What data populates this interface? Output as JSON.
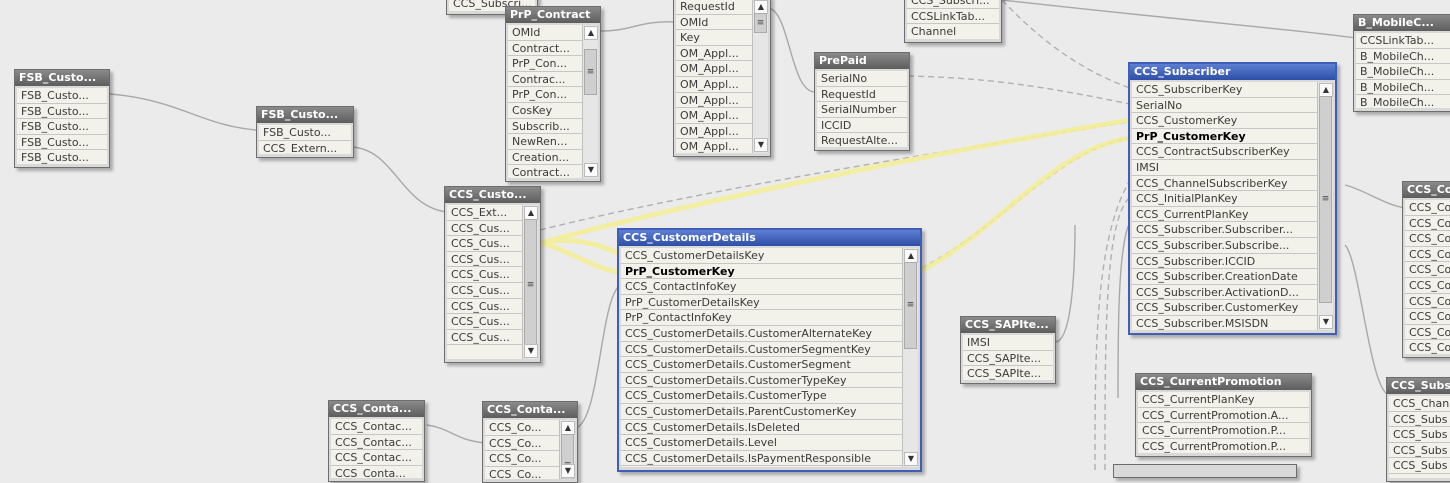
{
  "tables": [
    {
      "id": "ccs-subsc-top",
      "title": "",
      "fields": [
        "CCS_Subscri..."
      ]
    },
    {
      "id": "prp-contract",
      "title": "PrP_Contract",
      "fields": [
        "OMId",
        "Contract...",
        "PrP_Con...",
        "Contrac...",
        "PrP_Con...",
        "CosKey",
        "Subscrib...",
        "NewRen...",
        "Creation...",
        "Contract..."
      ]
    },
    {
      "id": "requestid",
      "title": "",
      "fields": [
        "RequestId",
        "OMId",
        "Key",
        "OM_Appl...",
        "OM_Appl...",
        "OM_Appl...",
        "OM_Appl...",
        "OM_Appl...",
        "OM_Appl...",
        "OM_Appl..."
      ]
    },
    {
      "id": "ccs-link",
      "title": "",
      "fields": [
        "CCS_Subscri...",
        "CCSLinkTab...",
        "Channel"
      ]
    },
    {
      "id": "b-mobilec",
      "title": "B_MobileC...",
      "fields": [
        "CCSLinkTab...",
        "B_MobileCh...",
        "B_MobileCh...",
        "B_MobileCh...",
        "B_MobileCh..."
      ]
    },
    {
      "id": "fsb-custo-1",
      "title": "FSB_Custo...",
      "fields": [
        "FSB_Custo...",
        "FSB_Custo...",
        "FSB_Custo...",
        "FSB_Custo...",
        "FSB_Custo..."
      ]
    },
    {
      "id": "fsb-custo-2",
      "title": "FSB_Custo...",
      "fields": [
        "FSB_Custo...",
        "CCS_Extern..."
      ]
    },
    {
      "id": "prepaid",
      "title": "PrePaid",
      "fields": [
        "SerialNo",
        "RequestId",
        "SerialNumber",
        "ICCID",
        "RequestAlte..."
      ]
    },
    {
      "id": "ccs-subscriber",
      "title": "CCS_Subscriber",
      "fields": [
        "CCS_SubscriberKey",
        "SerialNo",
        "CCS_CustomerKey",
        "PrP_CustomerKey",
        "CCS_ContractSubscriberKey",
        "IMSI",
        "CCS_ChannelSubscriberKey",
        "CCS_InitialPlanKey",
        "CCS_CurrentPlanKey",
        "CCS_Subscriber.Subscriber...",
        "CCS_Subscriber.Subscribe...",
        "CCS_Subscriber.ICCID",
        "CCS_Subscriber.CreationDate",
        "CCS_Subscriber.ActivationD...",
        "CCS_Subscriber.CustomerKey",
        "CCS_Subscriber.MSISDN"
      ]
    },
    {
      "id": "ccs-custo",
      "title": "CCS_Custo...",
      "fields": [
        "CCS_Ext...",
        "CCS_Cus...",
        "CCS_Cus...",
        "CCS_Cus...",
        "CCS_Cus...",
        "CCS_Cus...",
        "CCS_Cus...",
        "CCS_Cus...",
        "CCS_Cus..."
      ]
    },
    {
      "id": "ccs-customerdetails",
      "title": "CCS_CustomerDetails",
      "fields": [
        "CCS_CustomerDetailsKey",
        "PrP_CustomerKey",
        "CCS_ContactInfoKey",
        "PrP_CustomerDetailsKey",
        "PrP_ContactInfoKey",
        "CCS_CustomerDetails.CustomerAlternateKey",
        "CCS_CustomerDetails.CustomerSegmentKey",
        "CCS_CustomerDetails.CustomerSegment",
        "CCS_CustomerDetails.CustomerTypeKey",
        "CCS_CustomerDetails.CustomerType",
        "CCS_CustomerDetails.ParentCustomerKey",
        "CCS_CustomerDetails.IsDeleted",
        "CCS_CustomerDetails.Level",
        "CCS_CustomerDetails.IsPaymentResponsible"
      ]
    },
    {
      "id": "ccs-sapite",
      "title": "CCS_SAPIte...",
      "fields": [
        "IMSI",
        "CCS_SAPIte...",
        "CCS_SAPIte..."
      ]
    },
    {
      "id": "ccs-co-right",
      "title": "CCS_Co",
      "fields": [
        "CCS_Co",
        "CCS_Co",
        "CCS_Co",
        "CCS_Co",
        "CCS_Co",
        "CCS_Co",
        "CCS_Co",
        "CCS_Co",
        "CCS_Co",
        "CCS_Co"
      ]
    },
    {
      "id": "ccs-currentpromotion",
      "title": "CCS_CurrentPromotion",
      "fields": [
        "CCS_CurrentPlanKey",
        "CCS_CurrentPromotion.A...",
        "CCS_CurrentPromotion.P...",
        "CCS_CurrentPromotion.P..."
      ]
    },
    {
      "id": "ccs-subs-right",
      "title": "CCS_Subs",
      "fields": [
        "CCS_Chan",
        "CCS_Subs",
        "CCS_Subs",
        "CCS_Subs",
        "CCS_Subs"
      ]
    },
    {
      "id": "ccs-conta-1",
      "title": "CCS_Conta...",
      "fields": [
        "CCS_Contac...",
        "CCS_Contac...",
        "CCS_Contac...",
        "CCS_Conta..."
      ]
    },
    {
      "id": "ccs-conta-2",
      "title": "CCS_Conta...",
      "fields": [
        "CCS_Co...",
        "CCS_Co...",
        "CCS_Co...",
        "CCS_Co..."
      ]
    }
  ],
  "colors": {
    "background": "#ebebeb",
    "header": "#6e6e6e",
    "active_header": "#3f5fb6",
    "highlight_link": "#f5f0a0",
    "link": "#a8a8a8"
  }
}
